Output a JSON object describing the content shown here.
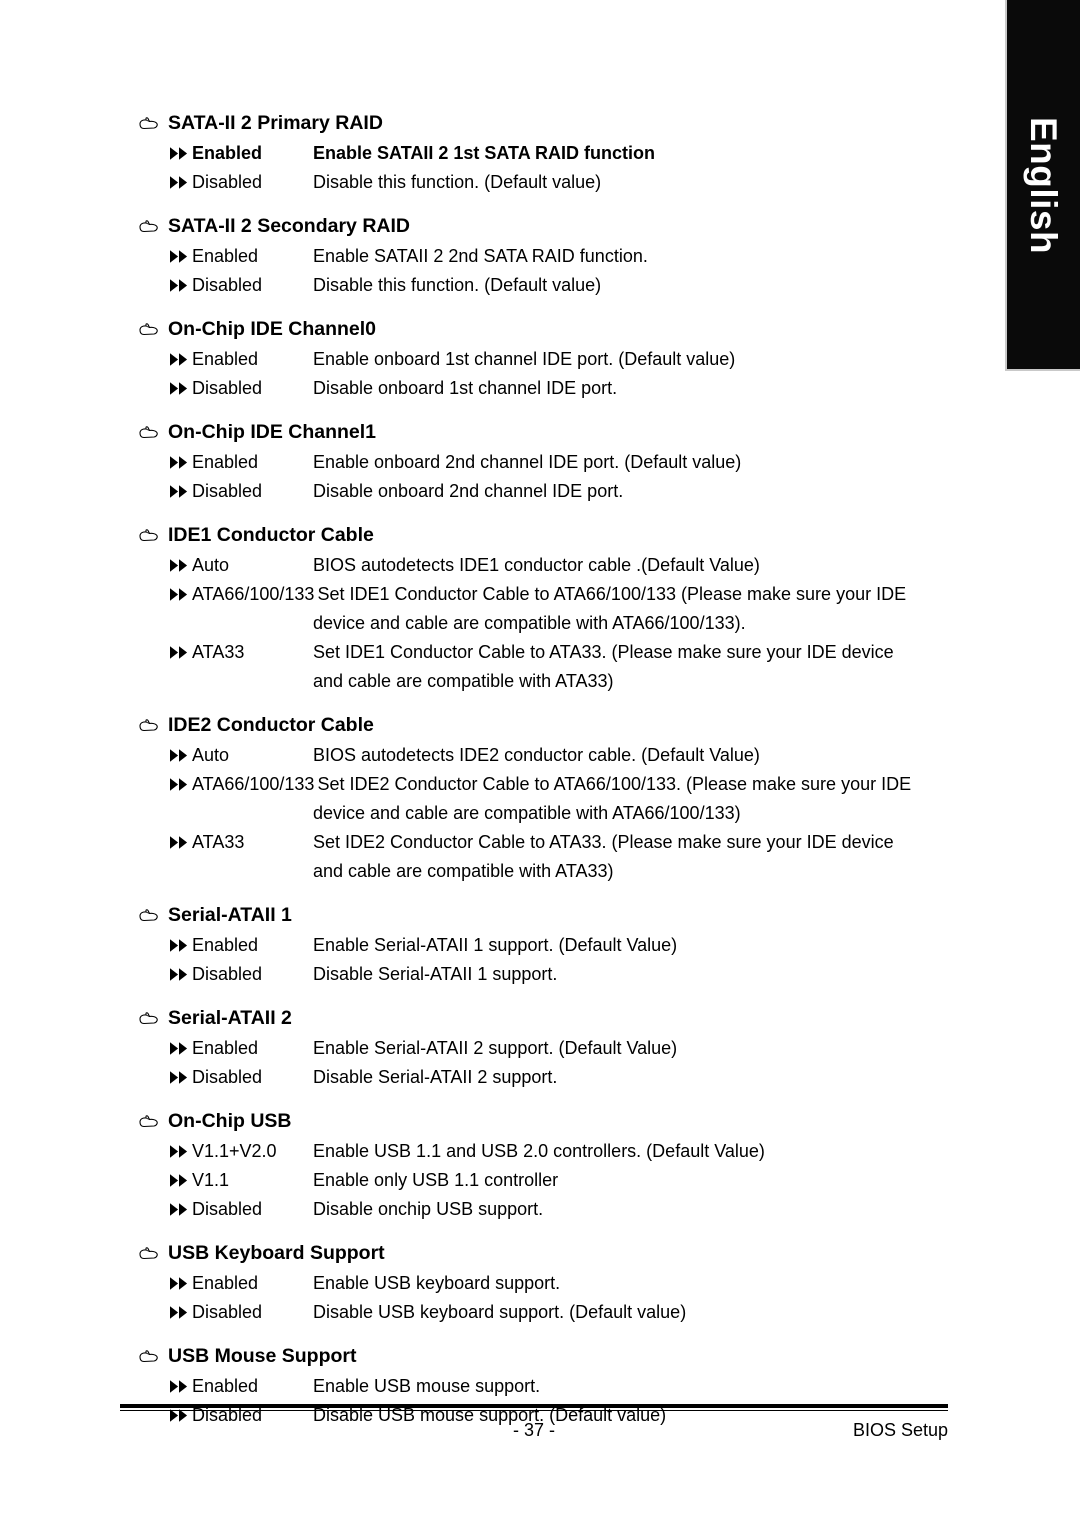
{
  "language_tab": {
    "label": "English"
  },
  "icons": {
    "heading_bullet": "pointing-hand-icon",
    "option_bullet": "double-right-arrow-icon"
  },
  "sections": [
    {
      "title": "SATA-II 2 Primary RAID",
      "options": [
        {
          "label": "Enabled",
          "desc": "Enable SATAII 2 1st SATA RAID function",
          "bold": true
        },
        {
          "label": "Disabled",
          "desc": "Disable this function. (Default value)"
        }
      ]
    },
    {
      "title": "SATA-II 2 Secondary RAID",
      "options": [
        {
          "label": "Enabled",
          "desc": "Enable SATAII 2 2nd SATA RAID function."
        },
        {
          "label": "Disabled",
          "desc": "Disable this function. (Default value)"
        }
      ]
    },
    {
      "title": "On-Chip IDE Channel0",
      "options": [
        {
          "label": "Enabled",
          "desc": "Enable onboard 1st channel IDE port. (Default value)"
        },
        {
          "label": "Disabled",
          "desc": "Disable onboard 1st channel IDE port."
        }
      ]
    },
    {
      "title": "On-Chip IDE Channel1",
      "options": [
        {
          "label": "Enabled",
          "desc": "Enable onboard 2nd channel IDE port. (Default value)"
        },
        {
          "label": "Disabled",
          "desc": "Disable onboard 2nd channel IDE port."
        }
      ]
    },
    {
      "title": "IDE1 Conductor Cable",
      "options": [
        {
          "label": "Auto",
          "desc": "BIOS autodetects IDE1 conductor cable .(Default Value)"
        },
        {
          "label": "ATA66/100/133",
          "wide": true,
          "desc": "Set IDE1 Conductor Cable to ATA66/100/133 (Please make sure your IDE",
          "cont": "device and cable are compatible with ATA66/100/133)."
        },
        {
          "label": "ATA33",
          "desc": "Set IDE1 Conductor Cable to ATA33. (Please make sure your IDE device",
          "cont": "and cable are compatible with ATA33)"
        }
      ]
    },
    {
      "title": "IDE2 Conductor Cable",
      "options": [
        {
          "label": "Auto",
          "desc": "BIOS autodetects IDE2 conductor cable. (Default Value)"
        },
        {
          "label": "ATA66/100/133",
          "wide": true,
          "desc": "Set IDE2 Conductor Cable to ATA66/100/133. (Please make sure your IDE",
          "cont": "device and cable are compatible with ATA66/100/133)"
        },
        {
          "label": "ATA33",
          "desc": "Set IDE2 Conductor Cable to ATA33. (Please make sure your IDE device",
          "cont": "and cable are compatible with ATA33)"
        }
      ]
    },
    {
      "title": "Serial-ATAII 1",
      "options": [
        {
          "label": "Enabled",
          "desc": "Enable Serial-ATAII 1 support. (Default Value)"
        },
        {
          "label": "Disabled",
          "desc": "Disable Serial-ATAII 1 support."
        }
      ]
    },
    {
      "title": "Serial-ATAII 2",
      "options": [
        {
          "label": "Enabled",
          "desc": "Enable Serial-ATAII 2 support. (Default Value)"
        },
        {
          "label": "Disabled",
          "desc": "Disable Serial-ATAII 2 support."
        }
      ]
    },
    {
      "title": "On-Chip USB",
      "options": [
        {
          "label": "V1.1+V2.0",
          "desc": "Enable USB 1.1 and USB 2.0 controllers. (Default Value)"
        },
        {
          "label": "V1.1",
          "desc": "Enable only USB 1.1 controller"
        },
        {
          "label": "Disabled",
          "desc": "Disable onchip USB support."
        }
      ]
    },
    {
      "title": "USB Keyboard Support",
      "options": [
        {
          "label": "Enabled",
          "desc": "Enable USB keyboard support."
        },
        {
          "label": "Disabled",
          "desc": "Disable USB keyboard support. (Default value)"
        }
      ]
    },
    {
      "title": "USB Mouse Support",
      "options": [
        {
          "label": "Enabled",
          "desc": "Enable USB mouse support."
        },
        {
          "label": "Disabled",
          "desc": "Disable USB mouse support. (Default value)"
        }
      ]
    }
  ],
  "footer": {
    "page_number": "- 37 -",
    "right_label": "BIOS Setup"
  }
}
